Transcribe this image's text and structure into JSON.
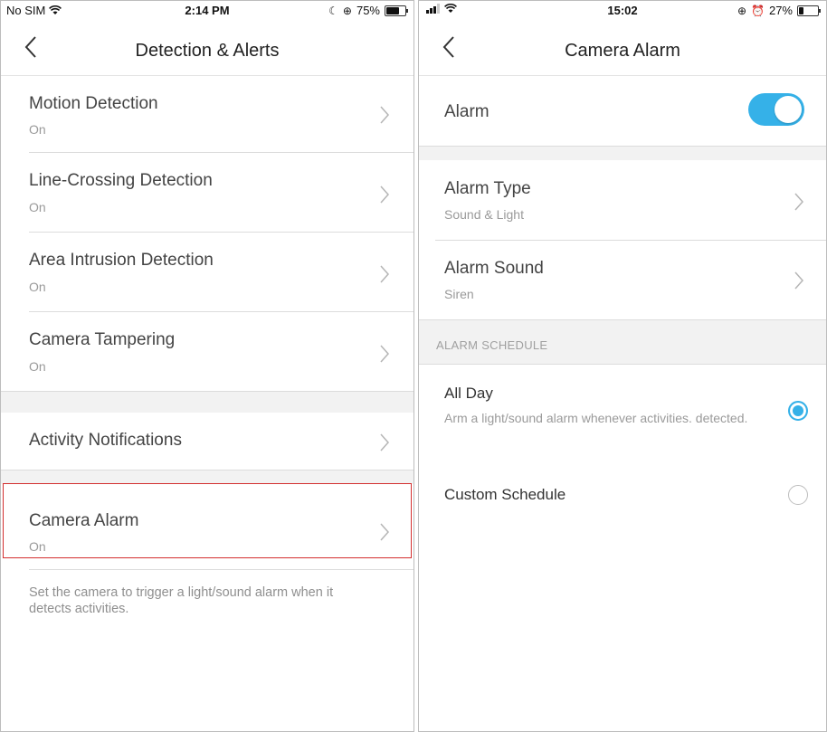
{
  "left": {
    "status": {
      "carrier": "No SIM",
      "time": "2:14 PM",
      "battery": "75%",
      "battery_level": 0.75
    },
    "nav": {
      "title": "Detection & Alerts"
    },
    "items": [
      {
        "label": "Motion Detection",
        "sub": "On"
      },
      {
        "label": "Line-Crossing Detection",
        "sub": "On"
      },
      {
        "label": "Area Intrusion Detection",
        "sub": "On"
      },
      {
        "label": "Camera Tampering",
        "sub": "On"
      }
    ],
    "activity": {
      "label": "Activity Notifications"
    },
    "camera_alarm": {
      "label": "Camera Alarm",
      "sub": "On"
    },
    "footnote": "Set the camera to trigger a light/sound alarm when it detects activities."
  },
  "right": {
    "status": {
      "time": "15:02",
      "battery": "27%",
      "battery_level": 0.27
    },
    "nav": {
      "title": "Camera Alarm"
    },
    "alarm": {
      "label": "Alarm",
      "enabled": true
    },
    "alarm_type": {
      "label": "Alarm Type",
      "sub": "Sound & Light"
    },
    "alarm_sound": {
      "label": "Alarm Sound",
      "sub": "Siren"
    },
    "schedule_header": "ALARM SCHEDULE",
    "all_day": {
      "label": "All Day",
      "desc": "Arm a light/sound alarm whenever activities. detected.",
      "selected": true
    },
    "custom": {
      "label": "Custom Schedule",
      "selected": false
    }
  },
  "colors": {
    "accent": "#35b1e8",
    "highlight": "#d32f2f"
  }
}
